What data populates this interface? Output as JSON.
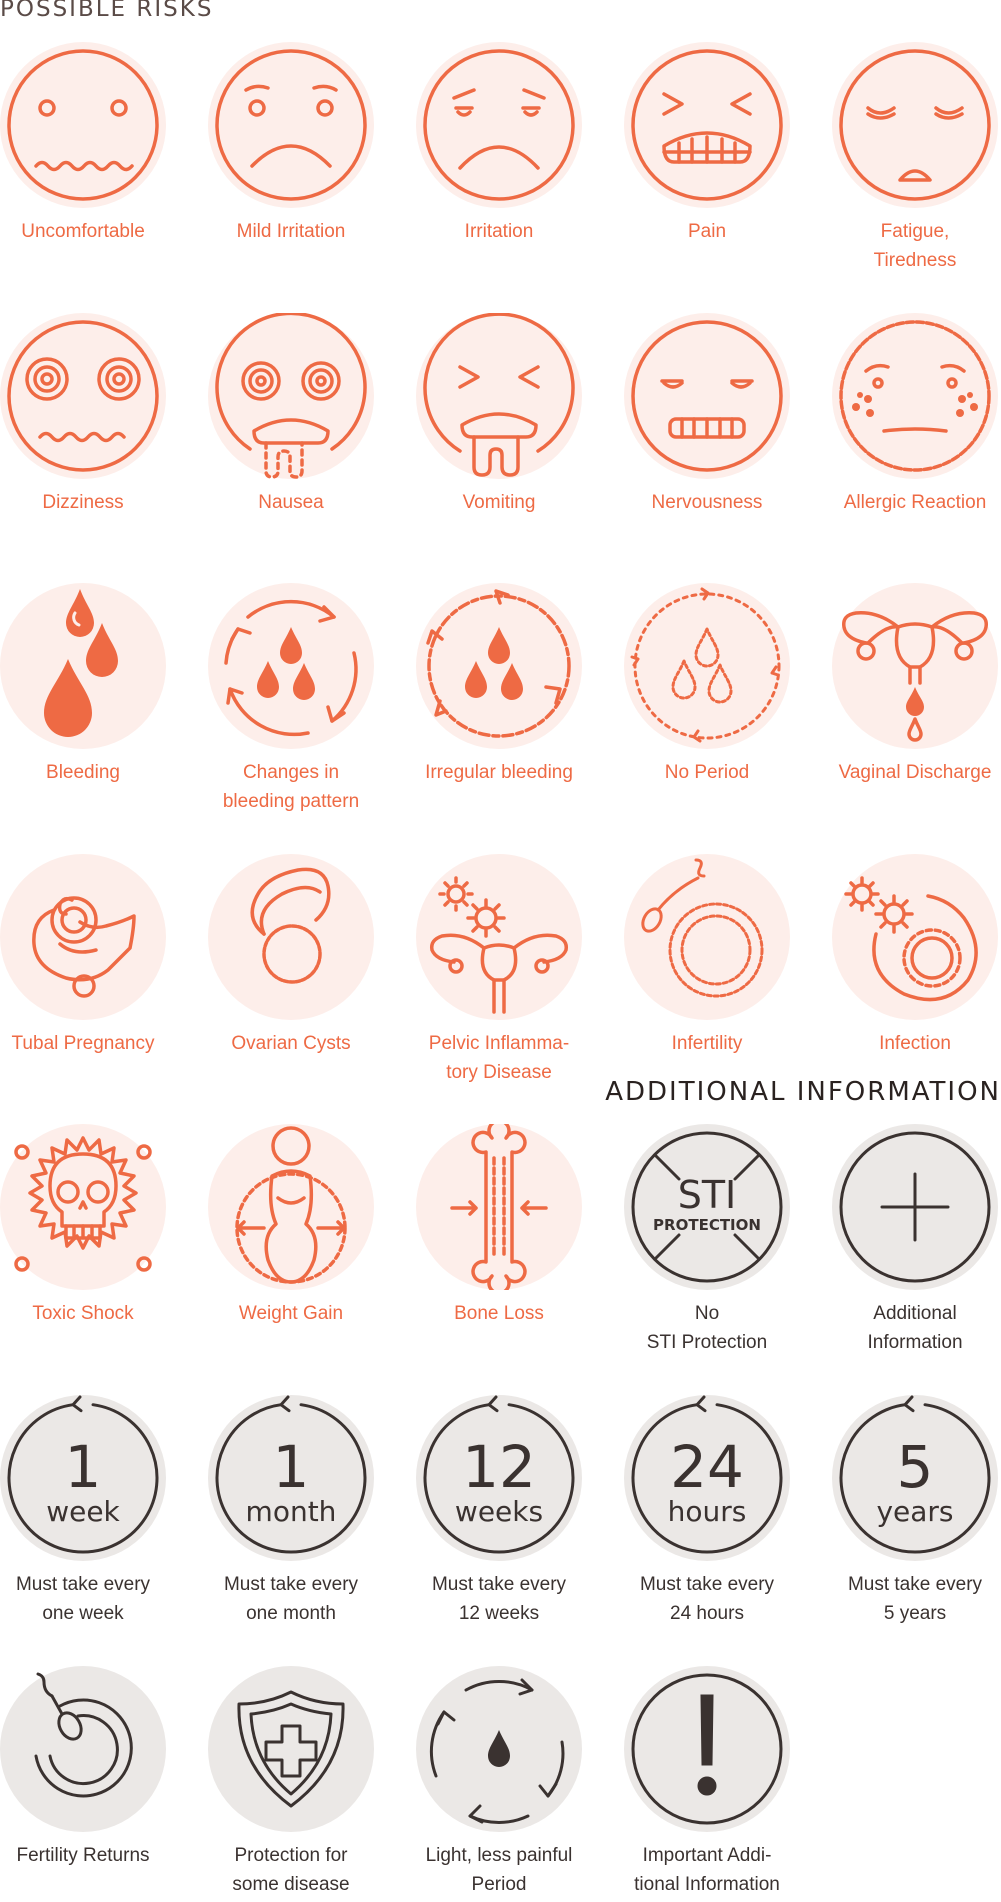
{
  "risks_title": "POSSIBLE RISKS",
  "info_title": "ADDITIONAL INFORMATION",
  "colors": {
    "risk_accent": "#ee6a44",
    "risk_disc": "#fdeeea",
    "info_ink": "#3a3230",
    "info_disc": "#ebe8e6"
  },
  "risks": [
    {
      "label": "Uncomfortable",
      "icon": "uncomfortable-face-icon"
    },
    {
      "label": "Mild Irritation",
      "icon": "mild-irritation-face-icon"
    },
    {
      "label": "Irritation",
      "icon": "irritation-face-icon"
    },
    {
      "label": "Pain",
      "icon": "pain-face-icon"
    },
    {
      "label": "Fatigue,\nTiredness",
      "icon": "fatigue-face-icon"
    },
    {
      "label": "Dizziness",
      "icon": "dizziness-face-icon"
    },
    {
      "label": "Nausea",
      "icon": "nausea-face-icon"
    },
    {
      "label": "Vomiting",
      "icon": "vomiting-face-icon"
    },
    {
      "label": "Nervousness",
      "icon": "nervousness-face-icon"
    },
    {
      "label": "Allergic Reaction",
      "icon": "allergic-reaction-face-icon"
    },
    {
      "label": "Bleeding",
      "icon": "bleeding-drops-icon"
    },
    {
      "label": "Changes in\nbleeding pattern",
      "icon": "bleeding-pattern-cycle-icon"
    },
    {
      "label": "Irregular bleeding",
      "icon": "irregular-bleeding-icon"
    },
    {
      "label": "No Period",
      "icon": "no-period-icon"
    },
    {
      "label": "Vaginal Discharge",
      "icon": "uterus-discharge-icon"
    },
    {
      "label": "Tubal Pregnancy",
      "icon": "tubal-pregnancy-icon"
    },
    {
      "label": "Ovarian Cysts",
      "icon": "ovarian-cyst-icon"
    },
    {
      "label": "Pelvic Inflamma-\ntory Disease",
      "icon": "pelvic-inflammation-icon"
    },
    {
      "label": "Infertility",
      "icon": "infertility-icon"
    },
    {
      "label": "Infection",
      "icon": "infection-germs-icon"
    },
    {
      "label": "Toxic Shock",
      "icon": "skull-crossbones-icon"
    },
    {
      "label": "Weight Gain",
      "icon": "weight-gain-body-icon"
    },
    {
      "label": "Bone Loss",
      "icon": "bone-loss-icon"
    }
  ],
  "info": [
    {
      "label": "No\nSTI Protection",
      "icon": "no-sti-protection-icon",
      "line1": "STI",
      "line2": "PROTECTION"
    },
    {
      "label": "Additional\nInformation",
      "icon": "plus-icon"
    },
    {
      "label": "Must take every\none week",
      "icon": "cycle-1-week-icon",
      "number": "1",
      "unit": "week"
    },
    {
      "label": "Must take every\none month",
      "icon": "cycle-1-month-icon",
      "number": "1",
      "unit": "month"
    },
    {
      "label": "Must take every\n12 weeks",
      "icon": "cycle-12-weeks-icon",
      "number": "12",
      "unit": "weeks"
    },
    {
      "label": "Must take every\n24 hours",
      "icon": "cycle-24-hours-icon",
      "number": "24",
      "unit": "hours"
    },
    {
      "label": "Must take every\n5 years",
      "icon": "cycle-5-years-icon",
      "number": "5",
      "unit": "years"
    },
    {
      "label": "Fertility Returns",
      "icon": "fertility-returns-icon"
    },
    {
      "label": "Protection for\nsome disease",
      "icon": "shield-cross-icon"
    },
    {
      "label": "Light, less painful\nPeriod",
      "icon": "light-period-cycle-icon"
    },
    {
      "label": "Important Addi-\ntional Information",
      "icon": "exclamation-icon"
    }
  ]
}
